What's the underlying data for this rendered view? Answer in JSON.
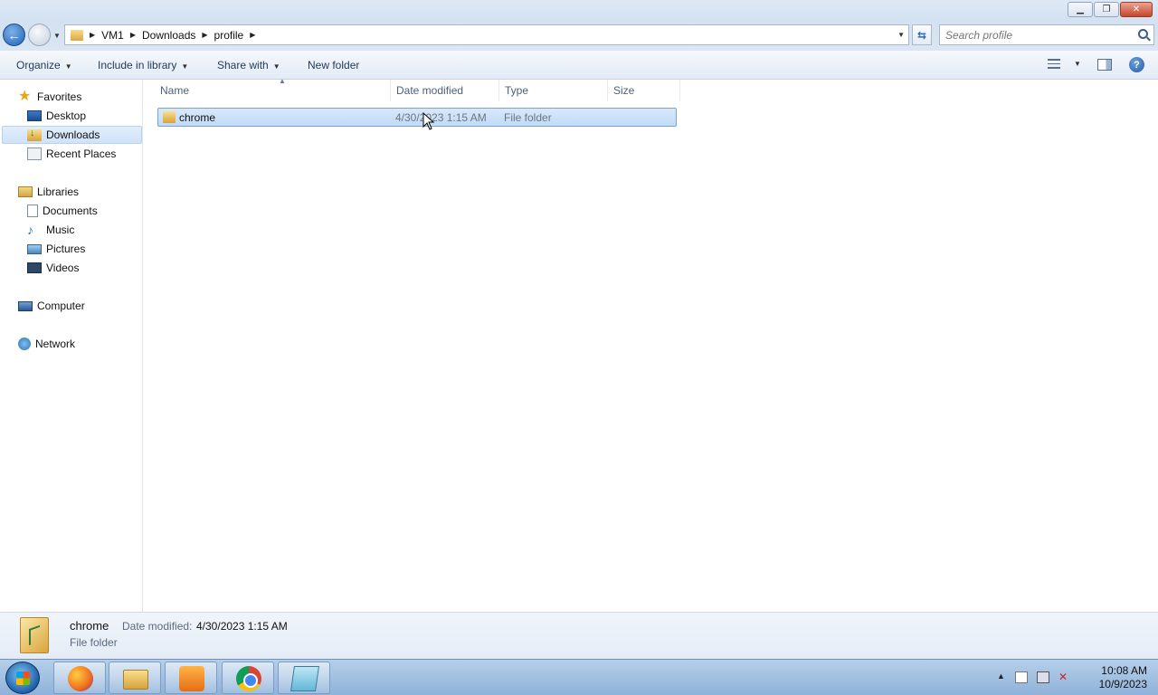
{
  "window": {
    "minimize_glyph": "▁",
    "maximize_glyph": "❐",
    "close_glyph": "✕"
  },
  "address": {
    "crumbs": [
      "VM1",
      "Downloads",
      "profile"
    ],
    "search_placeholder": "Search profile"
  },
  "toolbar": {
    "organize": "Organize",
    "include_in_library": "Include in library",
    "share_with": "Share with",
    "new_folder": "New folder"
  },
  "sidebar": {
    "favorites": "Favorites",
    "desktop": "Desktop",
    "downloads": "Downloads",
    "recent_places": "Recent Places",
    "libraries": "Libraries",
    "documents": "Documents",
    "music": "Music",
    "pictures": "Pictures",
    "videos": "Videos",
    "computer": "Computer",
    "network": "Network"
  },
  "columns": {
    "name": "Name",
    "date_modified": "Date modified",
    "type": "Type",
    "size": "Size"
  },
  "files": [
    {
      "name": "chrome",
      "date_modified": "4/30/2023 1:15 AM",
      "type": "File folder",
      "size": ""
    }
  ],
  "details": {
    "name": "chrome",
    "date_label": "Date modified:",
    "date_value": "4/30/2023 1:15 AM",
    "type": "File folder"
  },
  "taskbar": {
    "apps": [
      "firefox-icon",
      "explorer-icon",
      "media-player-icon",
      "chrome-icon",
      "notepad-icon"
    ],
    "time": "10:08 AM",
    "date": "10/9/2023"
  },
  "colors": {
    "selection": "#cde1f8",
    "accent": "#1e62b6"
  }
}
